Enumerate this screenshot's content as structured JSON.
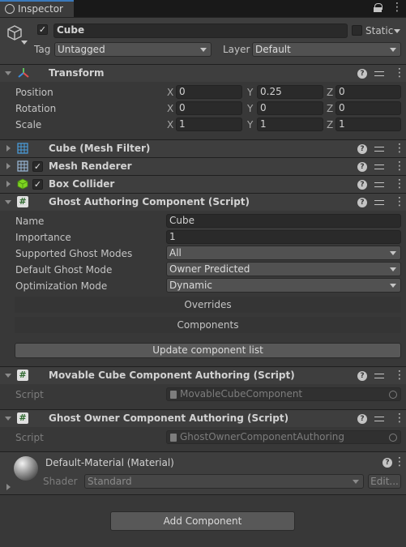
{
  "tab": {
    "title": "Inspector"
  },
  "gameobject": {
    "name": "Cube",
    "static_label": "Static",
    "tag_label": "Tag",
    "tag_value": "Untagged",
    "layer_label": "Layer",
    "layer_value": "Default"
  },
  "transform": {
    "title": "Transform",
    "rows": [
      {
        "label": "Position",
        "x": "0",
        "y": "0.25",
        "z": "0"
      },
      {
        "label": "Rotation",
        "x": "0",
        "y": "0",
        "z": "0"
      },
      {
        "label": "Scale",
        "x": "1",
        "y": "1",
        "z": "1"
      }
    ],
    "axis_x": "X",
    "axis_y": "Y",
    "axis_z": "Z"
  },
  "components": {
    "mesh_filter": "Cube (Mesh Filter)",
    "mesh_renderer": "Mesh Renderer",
    "box_collider": "Box Collider"
  },
  "ghost_authoring": {
    "title": "Ghost Authoring Component (Script)",
    "fields": [
      {
        "label": "Name",
        "value": "Cube"
      },
      {
        "label": "Importance",
        "value": "1"
      }
    ],
    "dropdowns": [
      {
        "label": "Supported Ghost Modes",
        "value": "All"
      },
      {
        "label": "Default Ghost Mode",
        "value": "Owner Predicted"
      },
      {
        "label": "Optimization Mode",
        "value": "Dynamic"
      }
    ],
    "overrides_label": "Overrides",
    "components_label": "Components",
    "update_button": "Update component list"
  },
  "movable_cube": {
    "title": "Movable Cube Component Authoring (Script)",
    "script_label": "Script",
    "script_value": "MovableCubeComponent"
  },
  "ghost_owner": {
    "title": "Ghost Owner Component Authoring (Script)",
    "script_label": "Script",
    "script_value": "GhostOwnerComponentAuthoring"
  },
  "material": {
    "title": "Default-Material (Material)",
    "shader_label": "Shader",
    "shader_value": "Standard",
    "edit_button": "Edit..."
  },
  "add_component_button": "Add Component",
  "icons": {
    "help": "?",
    "check": "✓",
    "script": "#"
  },
  "colors": {
    "background": "#383838",
    "header_background": "#3e3e3e",
    "field_background": "#2a2a2a",
    "tab_background": "#3c3c3c"
  }
}
